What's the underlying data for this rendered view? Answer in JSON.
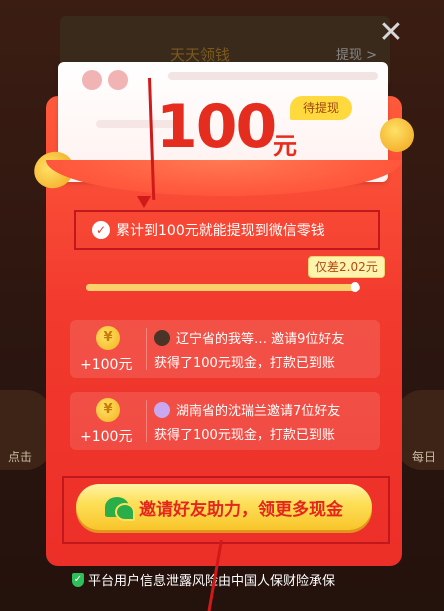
{
  "background": {
    "top_title": "天天领钱",
    "top_link": "提现 >",
    "left_label": "点击",
    "right_label": "每日"
  },
  "voucher": {
    "amount": "100",
    "unit": "元",
    "status_badge": "待提现"
  },
  "tip": {
    "text": "累计到100元就能提现到微信零钱"
  },
  "progress": {
    "remaining_label": "仅差2.02元",
    "fraction": 0.98
  },
  "records": [
    {
      "reward": "+100元",
      "line1": "辽宁省的我等… 邀请9位好友",
      "line2": "获得了100元现金，打款已到账"
    },
    {
      "reward": "+100元",
      "line1": "湖南省的沈瑞兰邀请7位好友",
      "line2": "获得了100元现金，打款已到账"
    }
  ],
  "coin_symbol": "¥",
  "cta": {
    "label": "邀请好友助力，领更多现金"
  },
  "footer": {
    "text": "平台用户信息泄露风险由中国人保财险承保"
  },
  "icons": {
    "close": "close-icon",
    "wechat": "wechat-icon",
    "shield": "shield-icon"
  },
  "colors": {
    "card_red": "#f23a2e",
    "amount_red": "#e52d1f",
    "badge_yellow": "#ffd93e",
    "button_yellow": "#fde05a",
    "annotation_red": "#c0181c"
  }
}
